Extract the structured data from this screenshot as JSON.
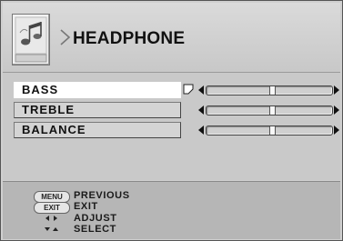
{
  "header": {
    "title": "HEADPHONE",
    "icon": "music-notes-icon"
  },
  "settings": [
    {
      "label": "BASS",
      "level_percent": 52,
      "selected": true
    },
    {
      "label": "TREBLE",
      "level_percent": 52,
      "selected": false
    },
    {
      "label": "BALANCE",
      "level_percent": 52,
      "selected": false
    }
  ],
  "legend": {
    "menu_key": "MENU",
    "menu_action": "PREVIOUS",
    "exit_key": "EXIT",
    "exit_action": "EXIT",
    "adjust_icon": "left-right-arrows-icon",
    "adjust_action": "ADJUST",
    "select_icon": "up-down-arrows-icon",
    "select_action": "SELECT"
  },
  "colors": {
    "background": "#cfcfcf",
    "selected_row": "#ffffff",
    "text": "#111111"
  }
}
